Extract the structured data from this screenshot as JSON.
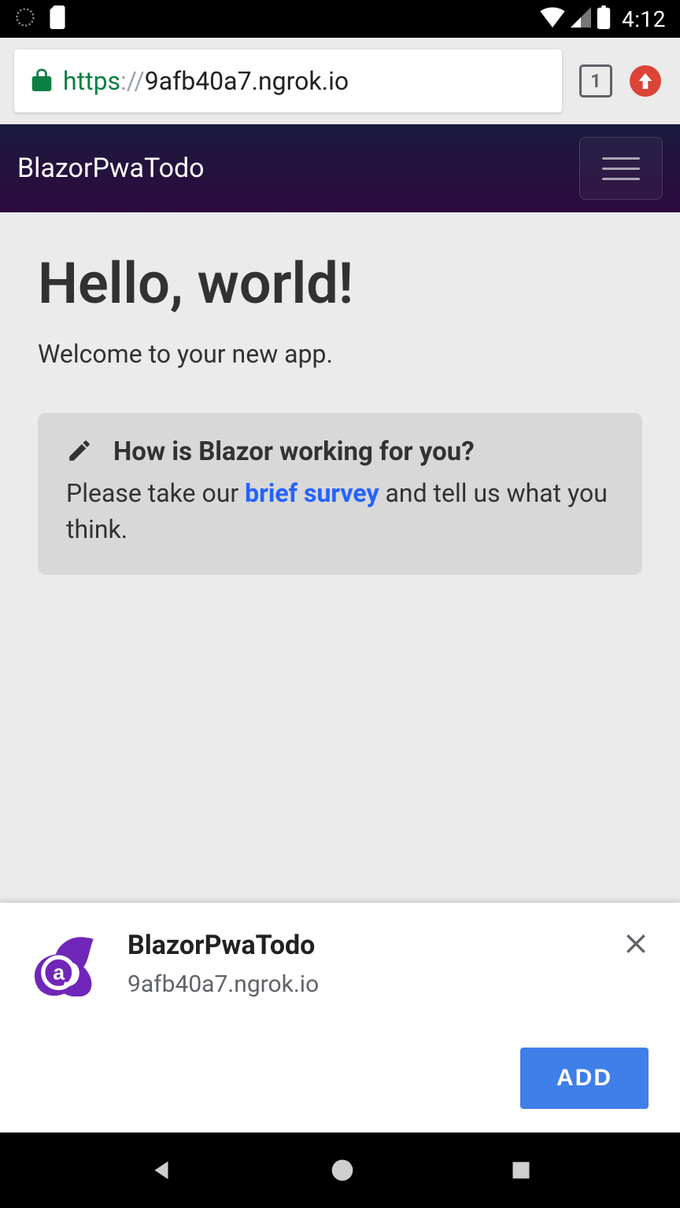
{
  "status_bar": {
    "time": "4:12",
    "tabs_count": "1"
  },
  "chrome": {
    "url_scheme": "https",
    "url_sep": "://",
    "url_host": "9afb40a7.ngrok.io"
  },
  "app": {
    "title": "BlazorPwaTodo"
  },
  "main": {
    "hero_title": "Hello, world!",
    "hero_subtitle": "Welcome to your new app.",
    "survey": {
      "title": "How is Blazor working for you?",
      "body_pre": "Please take our ",
      "link_text": "brief survey",
      "body_post": " and tell us what you think."
    }
  },
  "pwa": {
    "title": "BlazorPwaTodo",
    "host": "9afb40a7.ngrok.io",
    "add_label": "ADD"
  }
}
